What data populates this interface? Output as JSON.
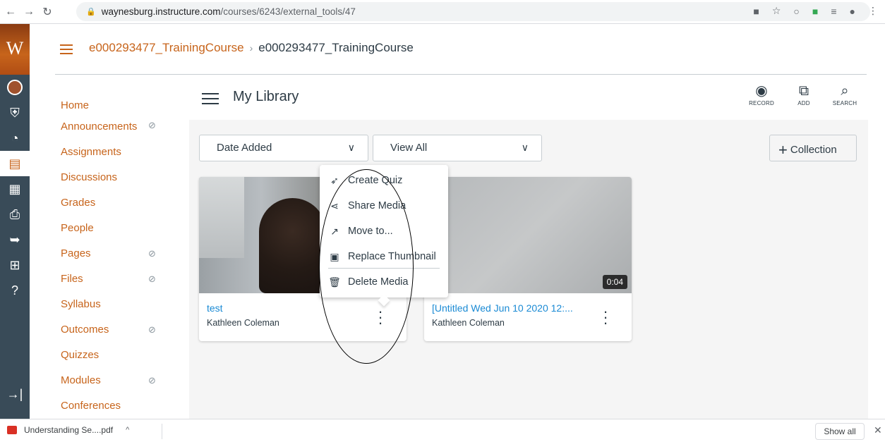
{
  "browser": {
    "url_host": "waynesburg.instructure.com",
    "url_path": "/courses/6243/external_tools/47"
  },
  "global_nav": {
    "logo_letter": "W"
  },
  "breadcrumb": {
    "course_link": "e000293477_TrainingCourse",
    "separator": "›",
    "current": "e000293477_TrainingCourse"
  },
  "course_nav": {
    "items": [
      {
        "label": "Home",
        "hidden": false
      },
      {
        "label": "Announcements",
        "hidden": true
      },
      {
        "label": "Assignments",
        "hidden": false
      },
      {
        "label": "Discussions",
        "hidden": false
      },
      {
        "label": "Grades",
        "hidden": false
      },
      {
        "label": "People",
        "hidden": false
      },
      {
        "label": "Pages",
        "hidden": true
      },
      {
        "label": "Files",
        "hidden": true
      },
      {
        "label": "Syllabus",
        "hidden": false
      },
      {
        "label": "Outcomes",
        "hidden": true
      },
      {
        "label": "Quizzes",
        "hidden": false
      },
      {
        "label": "Modules",
        "hidden": true
      },
      {
        "label": "Conferences",
        "hidden": false
      }
    ]
  },
  "library": {
    "title": "My Library",
    "tools": {
      "record": "RECORD",
      "add": "ADD",
      "search": "SEARCH"
    },
    "sort_select": "Date Added",
    "filter_select": "View All",
    "collection_button": "Collection"
  },
  "cards": [
    {
      "title": "test",
      "author": "Kathleen Coleman",
      "duration": ""
    },
    {
      "title": "[Untitled Wed Jun 10 2020 12:...",
      "author": "Kathleen Coleman",
      "duration": "0:04"
    }
  ],
  "context_menu": {
    "items": [
      {
        "label": "Create Quiz",
        "icon": "rocket-icon"
      },
      {
        "label": "Share Media",
        "icon": "share-icon"
      },
      {
        "label": "Move to...",
        "icon": "move-arrow-icon"
      },
      {
        "label": "Replace Thumbnail",
        "icon": "image-icon"
      },
      {
        "label": "Delete Media",
        "icon": "trash-icon"
      }
    ]
  },
  "downloads": {
    "file_name": "Understanding Se....pdf",
    "show_all": "Show all"
  },
  "colors": {
    "accent": "#c7641b",
    "link": "#1a8ad4",
    "nav_bg": "#394b58"
  }
}
